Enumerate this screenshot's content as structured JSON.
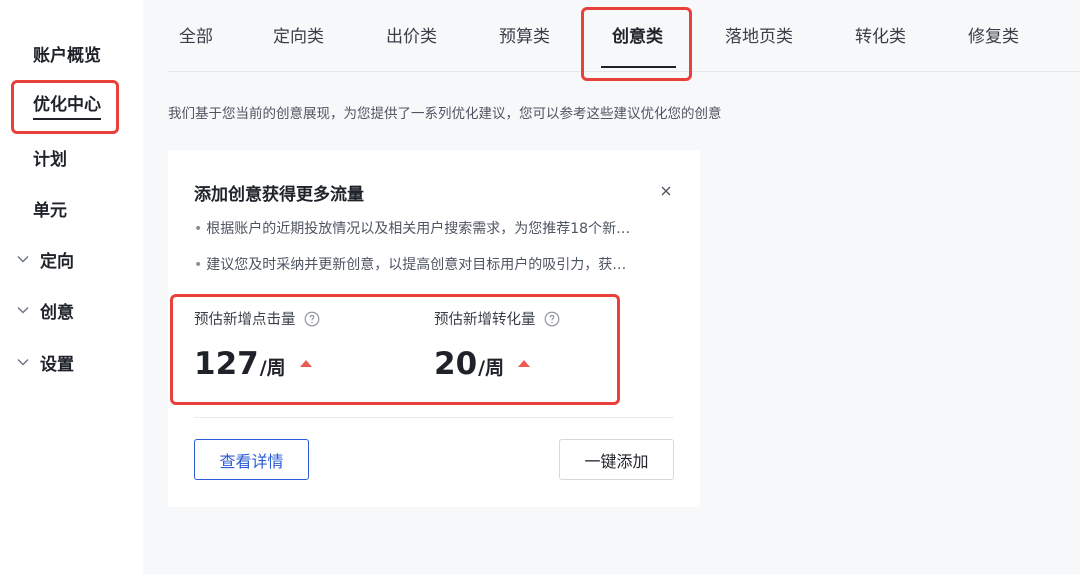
{
  "sidebar": {
    "items": [
      {
        "label": "账户概览",
        "type": "plain"
      },
      {
        "label": "优化中心",
        "type": "plain",
        "active": true
      },
      {
        "label": "计划",
        "type": "plain"
      },
      {
        "label": "单元",
        "type": "plain"
      },
      {
        "label": "定向",
        "type": "group",
        "icon": "chevron-down-icon"
      },
      {
        "label": "创意",
        "type": "group",
        "icon": "chevron-down-icon"
      },
      {
        "label": "设置",
        "type": "group",
        "icon": "chevron-down-icon"
      }
    ]
  },
  "tabs": [
    {
      "label": "全部"
    },
    {
      "label": "定向类"
    },
    {
      "label": "出价类"
    },
    {
      "label": "预算类"
    },
    {
      "label": "创意类",
      "active": true
    },
    {
      "label": "落地页类"
    },
    {
      "label": "转化类"
    },
    {
      "label": "修复类"
    }
  ],
  "intro": "我们基于您当前的创意展现，为您提供了一系列优化建议，您可以参考这些建议优化您的创意",
  "card": {
    "title": "添加创意获得更多流量",
    "close_icon": "close-icon",
    "bullets": [
      "根据账户的近期投放情况以及相关用户搜索需求，为您推荐18个新…",
      "建议您及时采纳并更新创意，以提高创意对目标用户的吸引力，获…"
    ],
    "metrics": [
      {
        "label": "预估新增点击量",
        "value": "127",
        "unit": "/周",
        "trend": "up"
      },
      {
        "label": "预估新增转化量",
        "value": "20",
        "unit": "/周",
        "trend": "up"
      }
    ],
    "buttons": {
      "details": "查看详情",
      "add_all": "一键添加"
    }
  },
  "colors": {
    "highlight": "#e8403a",
    "primary": "#2b5cd6",
    "trend_up": "#ee5b52"
  }
}
